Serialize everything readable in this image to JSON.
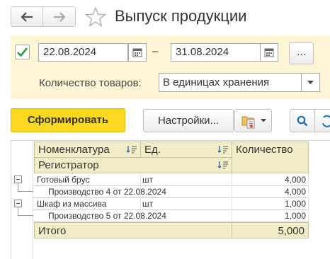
{
  "window": {
    "title": "Выпуск продукции"
  },
  "filter": {
    "period_enabled": true,
    "date_from": "22.08.2024",
    "date_separator": "–",
    "date_to": "31.08.2024",
    "choose_period_label": "...",
    "qty_label": "Количество товаров:",
    "qty_value": "В единицах хранения"
  },
  "toolbar": {
    "generate_label": "Сформировать",
    "settings_label": "Настройки..."
  },
  "report": {
    "headers": {
      "nomenclature": "Номенклатура",
      "unit": "Ед.",
      "quantity": "Количество",
      "registrar": "Регистратор"
    },
    "rows": [
      {
        "name": "Готовый брус",
        "unit": "шт",
        "qty": "4,000"
      },
      {
        "name": "Производство 4 от 22.08.2024",
        "unit": "",
        "qty": "4,000"
      },
      {
        "name": "Шкаф из массива",
        "unit": "шт",
        "qty": "1,000"
      },
      {
        "name": "Производство 5 от 22.08.2024",
        "unit": "",
        "qty": "1,000"
      }
    ],
    "total_label": "Итого",
    "total_value": "5,000"
  },
  "colors": {
    "accent_yellow": "#fbd921",
    "panel_bg": "#fdf5d3",
    "header_bg": "#f3ecc8",
    "check_green": "#2e9e3e",
    "search_blue": "#1e6eb0"
  }
}
